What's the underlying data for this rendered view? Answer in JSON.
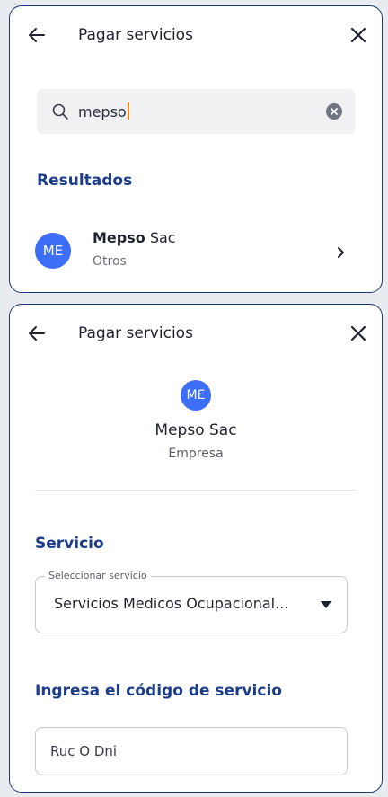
{
  "colors": {
    "accent": "#1c3d8c",
    "avatar": "#3d6ef7",
    "caret": "#f28a1a",
    "border": "#1f3a6e"
  },
  "search_screen": {
    "header": {
      "title": "Pagar servicios",
      "back_icon": "arrow-left-icon",
      "close_icon": "close-icon"
    },
    "search": {
      "value": "mepso",
      "icon": "search-icon",
      "clear_icon": "clear-icon"
    },
    "results_title": "Resultados",
    "results": [
      {
        "avatar": "ME",
        "name_bold": "Mepso",
        "name_rest": " Sac",
        "category": "Otros",
        "icon": "chevron-right-icon"
      }
    ]
  },
  "detail_screen": {
    "header": {
      "title": "Pagar servicios",
      "back_icon": "arrow-left-icon",
      "close_icon": "close-icon"
    },
    "company": {
      "avatar": "ME",
      "name": "Mepso Sac",
      "type": "Empresa"
    },
    "service_title": "Servicio",
    "service_select": {
      "label": "Seleccionar servicio",
      "value": "Servicios Medicos Ocupacional...",
      "icon": "dropdown-arrow-icon"
    },
    "code_title": "Ingresa el código de servicio",
    "code_field": {
      "placeholder": "Ruc O Dni"
    }
  }
}
